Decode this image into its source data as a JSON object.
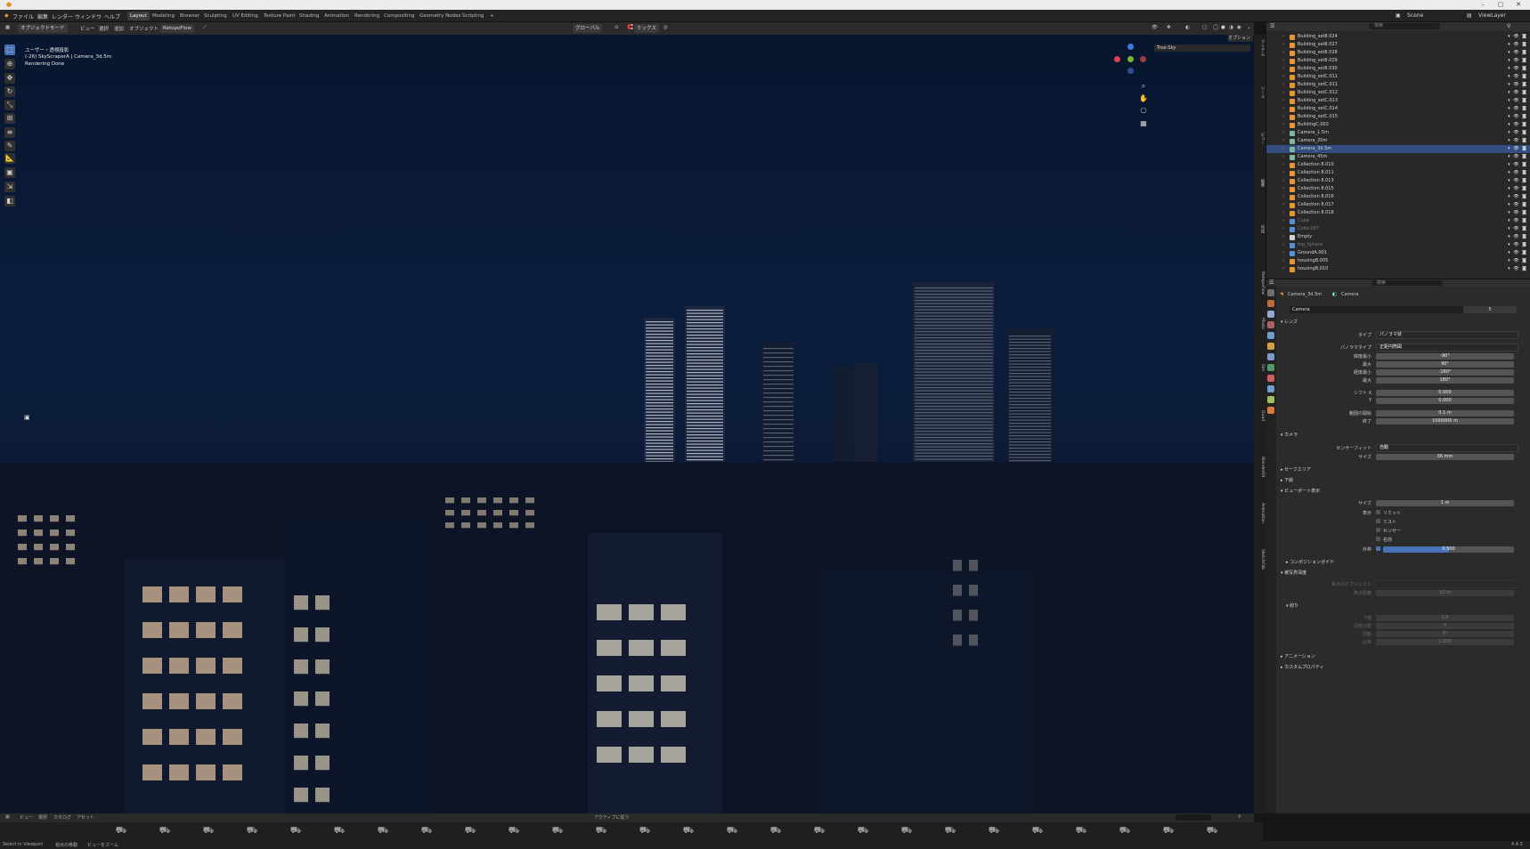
{
  "topbar": {
    "menus": [
      "ファイル",
      "編集",
      "レンダー",
      "ウィンドウ",
      "ヘルプ"
    ],
    "workspaces": [
      "Layout",
      "Modeling",
      "Browser",
      "Sculpting",
      "UV Editing",
      "Texture Paint",
      "Shading",
      "Animation",
      "Rendering",
      "Compositing",
      "Geometry Nodes",
      "Scripting"
    ],
    "active_workspace": "Layout",
    "add_tab": "+",
    "scene_label": "Scene",
    "viewlayer_label": "ViewLayer"
  },
  "vpheader": {
    "mode": "オブジェクトモード",
    "menus": [
      "ビュー",
      "選択",
      "追加",
      "オブジェクト"
    ],
    "addon": "RetopoFlow",
    "transform": "グローバル",
    "snap": "ミックス",
    "overlay_label": "オプション"
  },
  "viewport": {
    "info_view": "ユーザー・透視投影",
    "info_object": "(-26) SkyScraperA | Camera_3d.5m",
    "info_status": "Rendering Done",
    "sky_label": "True-Sky"
  },
  "ntabs": [
    "アイテム",
    "ツール",
    "ビュー",
    "編集",
    "作成",
    "RetopoFlow",
    "Photo",
    "Sim",
    "Quad",
    "BlenderKit",
    "Animation",
    "SketchFab"
  ],
  "outliner": {
    "search_placeholder": "検索",
    "rows": [
      {
        "name": "Building_set8.024",
        "type": "obj"
      },
      {
        "name": "Building_set8.027",
        "type": "obj"
      },
      {
        "name": "Building_set8.028",
        "type": "obj"
      },
      {
        "name": "Building_set8.029",
        "type": "obj"
      },
      {
        "name": "Building_set8.030",
        "type": "obj"
      },
      {
        "name": "Building_setC.011",
        "type": "obj"
      },
      {
        "name": "Building_setC.011",
        "type": "obj"
      },
      {
        "name": "Building_setC.012",
        "type": "obj"
      },
      {
        "name": "Building_setC.013",
        "type": "obj"
      },
      {
        "name": "Building_setC.014",
        "type": "obj"
      },
      {
        "name": "Building_setC.015",
        "type": "obj"
      },
      {
        "name": "BuildingC.002",
        "type": "obj"
      },
      {
        "name": "Camera_1.5m",
        "type": "cam"
      },
      {
        "name": "Camera_20m",
        "type": "cam"
      },
      {
        "name": "Camera_3d.5m",
        "type": "cam",
        "selected": true
      },
      {
        "name": "Camera_45m",
        "type": "cam"
      },
      {
        "name": "Collection 8.010",
        "type": "obj"
      },
      {
        "name": "Collection 8.011",
        "type": "obj"
      },
      {
        "name": "Collection 8.013",
        "type": "obj"
      },
      {
        "name": "Collection 8.015",
        "type": "obj"
      },
      {
        "name": "Collection 8.016",
        "type": "obj"
      },
      {
        "name": "Collection 8.017",
        "type": "obj"
      },
      {
        "name": "Collection 8.018",
        "type": "obj"
      },
      {
        "name": "Cube",
        "type": "mesh",
        "dim": true
      },
      {
        "name": "Cube.007",
        "type": "mesh",
        "dim": true
      },
      {
        "name": "Empty",
        "type": "empty"
      },
      {
        "name": "fog_Sphere",
        "type": "mesh",
        "dim": true
      },
      {
        "name": "GroundA.001",
        "type": "mesh"
      },
      {
        "name": "housingB.005",
        "type": "obj"
      },
      {
        "name": "housingB.010",
        "type": "obj"
      }
    ]
  },
  "properties": {
    "breadcrumb_object": "Camera_3d.5m",
    "breadcrumb_data": "Camera",
    "datablock": "Camera",
    "user_count": "5",
    "search_placeholder": "検索",
    "sec_lens": "レンズ",
    "type_label": "タイプ",
    "type_value": "パノラマ状",
    "pano_label": "パノラマタイプ",
    "pano_value": "正距円筒図",
    "lat_min_label": "緯度最小",
    "lat_min": "-90°",
    "lat_max_label": "最大",
    "lat_max": "90°",
    "lon_min_label": "経度最小",
    "lon_min": "-180°",
    "lon_max_label": "最大",
    "lon_max": "180°",
    "shift_x_label": "シフト X",
    "shift_x": "0.000",
    "shift_y_label": "Y",
    "shift_y": "0.000",
    "clip_start_label": "範囲の開始",
    "clip_start": "0.1 m",
    "clip_end_label": "終了",
    "clip_end": "1000000 m",
    "sec_camera": "カメラ",
    "sensor_fit_label": "センサーフィット",
    "sensor_fit": "自動",
    "size_label": "サイズ",
    "sensor_size": "36 mm",
    "sec_safe": "セーフエリア",
    "sec_bg": "下絵",
    "sec_viewport": "ビューポート表示",
    "vp_size_label": "サイズ",
    "vp_size": "1 m",
    "show_label": "表示",
    "chk_limits": "リミット",
    "chk_mist": "ミスト",
    "chk_sensor": "センサー",
    "chk_name": "名前",
    "passepartout_label": "外枠",
    "passepartout": "0.500",
    "passepartout_value": 0.5,
    "sec_comp": "コンポジションガイド",
    "sec_dof": "被写界深度",
    "focus_obj_label": "焦点のオブジェクト",
    "focus_dist_label": "焦点距離",
    "focus_dist": "10 m",
    "sec_aperture": "絞り",
    "fstop_label": "F値",
    "fstop": "2.8",
    "blades_label": "羽根の数",
    "blades": "0",
    "rotation_label": "回転",
    "rotation": "0°",
    "ratio_label": "比率",
    "ratio": "1.000",
    "sec_anim": "アニメーション",
    "sec_custom": "カスタムプロパティ"
  },
  "assetbar": {
    "menus": [
      "ビュー",
      "選択",
      "カタログ",
      "アセット"
    ],
    "apply_label": "アクティブに従う"
  },
  "statusbar": {
    "left1": "Select in Viewport",
    "left2": "視点の移動",
    "left3": "ビューをズーム",
    "version": "4.4.3"
  },
  "colors": {
    "accent": "#4772b3",
    "selected_row": "#334d80",
    "object_icon": "#e6953a"
  }
}
